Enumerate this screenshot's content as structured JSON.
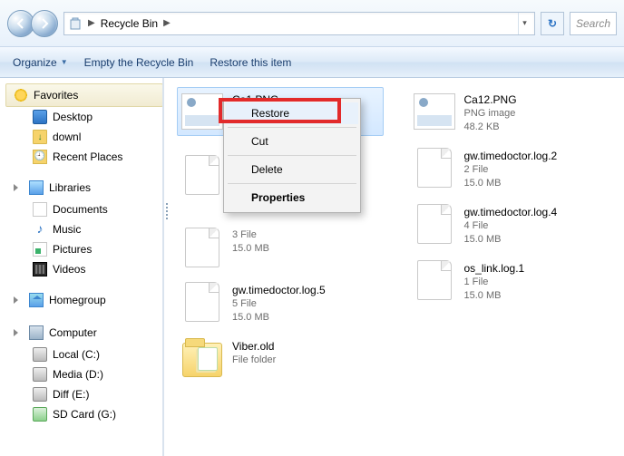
{
  "titlebar": {
    "location": "Recycle Bin",
    "search_placeholder": "Search",
    "refresh_glyph": "↻"
  },
  "toolbar": {
    "organize": "Organize",
    "empty": "Empty the Recycle Bin",
    "restore": "Restore this item"
  },
  "sidebar": {
    "favorites_label": "Favorites",
    "favorites": [
      {
        "label": "Desktop"
      },
      {
        "label": "downl"
      },
      {
        "label": "Recent Places"
      }
    ],
    "libraries_label": "Libraries",
    "libraries": [
      {
        "label": "Documents"
      },
      {
        "label": "Music"
      },
      {
        "label": "Pictures"
      },
      {
        "label": "Videos"
      }
    ],
    "homegroup_label": "Homegroup",
    "computer_label": "Computer",
    "computer": [
      {
        "label": "Local (C:)"
      },
      {
        "label": "Media (D:)"
      },
      {
        "label": "Diff (E:)"
      },
      {
        "label": "SD Card (G:)"
      }
    ]
  },
  "files": {
    "col1": [
      {
        "name": "Ca1.PNG",
        "line2": "",
        "line3": ""
      },
      {
        "name": "",
        "line2": "3 File",
        "line3": "15.0 MB"
      },
      {
        "name": "gw.timedoctor.log.5",
        "line2": "5 File",
        "line3": "15.0 MB"
      },
      {
        "name": "Viber.old",
        "line2": "File folder",
        "line3": ""
      }
    ],
    "col2": [
      {
        "name": "Ca12.PNG",
        "line2": "PNG image",
        "line3": "48.2 KB"
      },
      {
        "name": "gw.timedoctor.log.2",
        "line2": "2 File",
        "line3": "15.0 MB"
      },
      {
        "name": "gw.timedoctor.log.4",
        "line2": "4 File",
        "line3": "15.0 MB"
      },
      {
        "name": "os_link.log.1",
        "line2": "1 File",
        "line3": "15.0 MB"
      }
    ]
  },
  "context_menu": {
    "restore": "Restore",
    "cut": "Cut",
    "delete": "Delete",
    "properties": "Properties"
  }
}
